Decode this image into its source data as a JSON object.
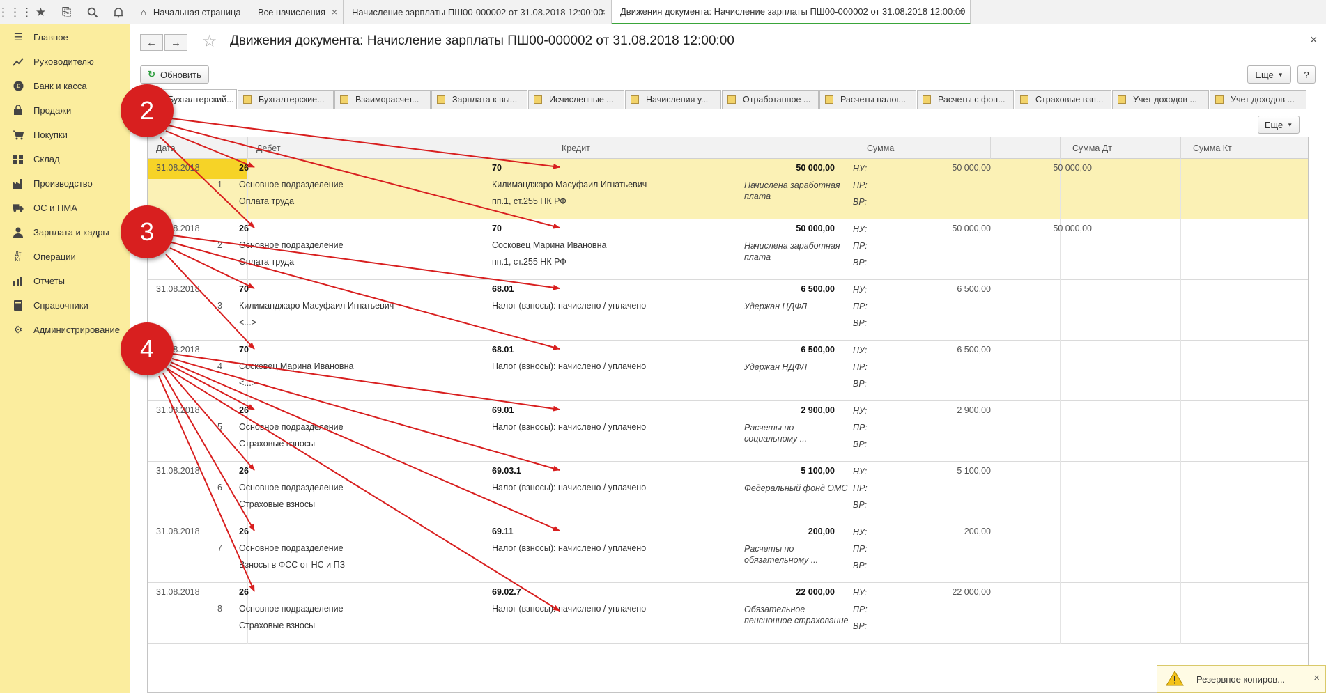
{
  "topbar": {
    "icons": [
      "apps-grid-icon",
      "star-icon",
      "history-icon",
      "search-icon",
      "bell-icon"
    ],
    "home_icon": "home-icon",
    "tabs": [
      {
        "label": "Начальная страница"
      },
      {
        "label": "Все начисления"
      },
      {
        "label": "Начисление зарплаты ПШ00-000002 от 31.08.2018 12:00:00"
      },
      {
        "label": "Движения документа: Начисление зарплаты ПШ00-000002 от 31.08.2018 12:00:00"
      }
    ],
    "close_glyph": "×"
  },
  "sidebar": {
    "items": [
      {
        "label": "Главное",
        "icon": "menu-lines-icon"
      },
      {
        "label": "Руководителю",
        "icon": "chart-line-icon"
      },
      {
        "label": "Банк и касса",
        "icon": "ruble-coin-icon"
      },
      {
        "label": "Продажи",
        "icon": "shopping-bag-icon"
      },
      {
        "label": "Покупки",
        "icon": "cart-icon"
      },
      {
        "label": "Склад",
        "icon": "warehouse-grid-icon"
      },
      {
        "label": "Производство",
        "icon": "factory-icon"
      },
      {
        "label": "ОС и НМА",
        "icon": "truck-icon"
      },
      {
        "label": "Зарплата и кадры",
        "icon": "person-icon"
      },
      {
        "label": "Операции",
        "icon": "dt-kt-icon"
      },
      {
        "label": "Отчеты",
        "icon": "report-chart-icon"
      },
      {
        "label": "Справочники",
        "icon": "book-icon"
      },
      {
        "label": "Администрирование",
        "icon": "gear-icon"
      }
    ]
  },
  "header": {
    "back_glyph": "←",
    "forward_glyph": "→",
    "star_glyph": "☆",
    "title": "Движения документа: Начисление зарплаты ПШ00-000002 от 31.08.2018 12:00:00",
    "close_glyph": "×",
    "refresh_label": "Обновить",
    "more_label": "Еще",
    "help_label": "?"
  },
  "register_tabs": [
    {
      "label": "Бухгалтерский..."
    },
    {
      "label": "Бухгалтерские..."
    },
    {
      "label": "Взаиморасчет..."
    },
    {
      "label": "Зарплата к вы..."
    },
    {
      "label": "Исчисленные ..."
    },
    {
      "label": "Начисления у..."
    },
    {
      "label": "Отработанное ..."
    },
    {
      "label": "Расчеты налог..."
    },
    {
      "label": "Расчеты с фон..."
    },
    {
      "label": "Страховые взн..."
    },
    {
      "label": "Учет доходов ..."
    },
    {
      "label": "Учет доходов ..."
    }
  ],
  "grid": {
    "more_label": "Еще",
    "columns": [
      "Дата",
      "Дебет",
      "Кредит",
      "Сумма",
      "",
      "Сумма Дт",
      "Сумма Кт"
    ],
    "row_labels": [
      "НУ:",
      "ПР:",
      "ВР:"
    ],
    "entries": [
      {
        "date": "31.08.2018",
        "num": "1",
        "debit": "26",
        "debit_sub1": "Основное подразделение",
        "debit_sub2": "Оплата труда",
        "credit": "70",
        "credit_sub1": "Килиманджаро Масуфаил Игнатьевич",
        "credit_sub2": "пп.1, ст.255 НК РФ",
        "sum": "50 000,00",
        "content": "Начислена заработная плата",
        "sum_dt": "50 000,00",
        "sum_kt": "50 000,00"
      },
      {
        "date": "31.08.2018",
        "num": "2",
        "debit": "26",
        "debit_sub1": "Основное подразделение",
        "debit_sub2": "Оплата труда",
        "credit": "70",
        "credit_sub1": "Сосковец Марина Ивановна",
        "credit_sub2": "пп.1, ст.255 НК РФ",
        "sum": "50 000,00",
        "content": "Начислена заработная плата",
        "sum_dt": "50 000,00",
        "sum_kt": "50 000,00"
      },
      {
        "date": "31.08.2018",
        "num": "3",
        "debit": "70",
        "debit_sub1": "Килиманджаро Масуфаил Игнатьевич",
        "debit_sub2": "<...>",
        "credit": "68.01",
        "credit_sub1": "Налог (взносы): начислено / уплачено",
        "credit_sub2": "",
        "sum": "6 500,00",
        "content": "Удержан НДФЛ",
        "sum_dt": "6 500,00",
        "sum_kt": ""
      },
      {
        "date": "31.08.2018",
        "num": "4",
        "debit": "70",
        "debit_sub1": "Сосковец Марина Ивановна",
        "debit_sub2": "<...>",
        "credit": "68.01",
        "credit_sub1": "Налог (взносы): начислено / уплачено",
        "credit_sub2": "",
        "sum": "6 500,00",
        "content": "Удержан НДФЛ",
        "sum_dt": "6 500,00",
        "sum_kt": ""
      },
      {
        "date": "31.08.2018",
        "num": "5",
        "debit": "26",
        "debit_sub1": "Основное подразделение",
        "debit_sub2": "Страховые взносы",
        "credit": "69.01",
        "credit_sub1": "Налог (взносы): начислено / уплачено",
        "credit_sub2": "",
        "sum": "2 900,00",
        "content": "Расчеты по социальному ...",
        "sum_dt": "2 900,00",
        "sum_kt": ""
      },
      {
        "date": "31.08.2018",
        "num": "6",
        "debit": "26",
        "debit_sub1": "Основное подразделение",
        "debit_sub2": "Страховые взносы",
        "credit": "69.03.1",
        "credit_sub1": "Налог (взносы): начислено / уплачено",
        "credit_sub2": "",
        "sum": "5 100,00",
        "content": "Федеральный фонд ОМС",
        "sum_dt": "5 100,00",
        "sum_kt": ""
      },
      {
        "date": "31.08.2018",
        "num": "7",
        "debit": "26",
        "debit_sub1": "Основное подразделение",
        "debit_sub2": "Взносы в ФСС от НС и ПЗ",
        "credit": "69.11",
        "credit_sub1": "Налог (взносы): начислено / уплачено",
        "credit_sub2": "",
        "sum": "200,00",
        "content": "Расчеты по обязательному ...",
        "sum_dt": "200,00",
        "sum_kt": ""
      },
      {
        "date": "31.08.2018",
        "num": "8",
        "debit": "26",
        "debit_sub1": "Основное подразделение",
        "debit_sub2": "Страховые взносы",
        "credit": "69.02.7",
        "credit_sub1": "Налог (взносы): начислено / уплачено",
        "credit_sub2": "",
        "sum": "22 000,00",
        "content": "Обязательное пенсионное страхование",
        "sum_dt": "22 000,00",
        "sum_kt": ""
      }
    ]
  },
  "annotations": {
    "markers": [
      {
        "label": "2"
      },
      {
        "label": "3"
      },
      {
        "label": "4"
      }
    ],
    "color": "#d81f1f"
  },
  "notification": {
    "icon": "warning-icon",
    "text": "Резервное копиров...",
    "close_glyph": "×"
  },
  "colors": {
    "sidebar_bg": "#fbed9e",
    "selected_row_bg": "#fbf1b5",
    "selected_cell_bg": "#f6d327",
    "active_tab_underline": "#3aa53a"
  }
}
